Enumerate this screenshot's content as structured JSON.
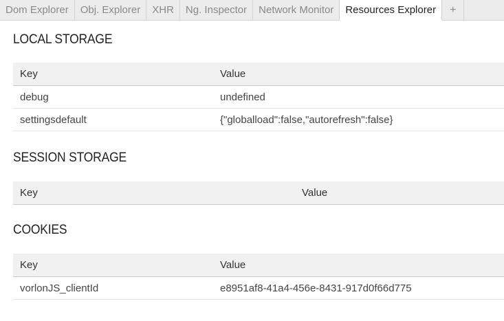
{
  "tabs": [
    {
      "label": "Dom Explorer",
      "active": false
    },
    {
      "label": "Obj. Explorer",
      "active": false
    },
    {
      "label": "XHR",
      "active": false
    },
    {
      "label": "Ng. Inspector",
      "active": false
    },
    {
      "label": "Network Monitor",
      "active": false
    },
    {
      "label": "Resources Explorer",
      "active": true
    },
    {
      "label": "+",
      "active": false
    }
  ],
  "local_storage": {
    "title": "LOCAL STORAGE",
    "columns": [
      "Key",
      "Value"
    ],
    "rows": [
      {
        "key": "debug",
        "value": "undefined"
      },
      {
        "key": "settingsdefault",
        "value": "{\"globalload\":false,\"autorefresh\":false}"
      }
    ]
  },
  "session_storage": {
    "title": "SESSION STORAGE",
    "columns": [
      "Key",
      "Value"
    ],
    "rows": []
  },
  "cookies": {
    "title": "COOKIES",
    "columns": [
      "Key",
      "Value"
    ],
    "rows": [
      {
        "key": "vorlonJS_clientId",
        "value": "e8951af8-41a4-456e-8431-917d0f66d775"
      }
    ]
  },
  "colors": {
    "tabbar_bg": "#ececec",
    "active_tab_bg": "#ffffff",
    "table_header_bg": "#f1f1f1"
  }
}
